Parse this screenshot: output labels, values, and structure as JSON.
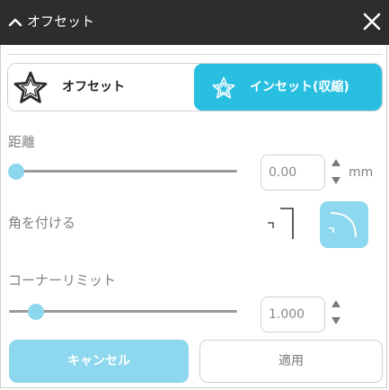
{
  "window": {
    "title": "オフセット"
  },
  "mode_toggle": {
    "offset_label": "オフセット",
    "inset_label": "インセット(収縮)",
    "selected": "inset"
  },
  "distance": {
    "label": "距離",
    "value": "0.00",
    "unit": "mm",
    "slider_level": 0
  },
  "corners": {
    "label": "角を付ける",
    "selected": "rounded"
  },
  "corner_limit": {
    "label": "コーナーリミット",
    "value": "1.000",
    "slider_level": 0.12
  },
  "footer": {
    "cancel_label": "キャンセル",
    "apply_label": "適用"
  },
  "colors": {
    "accent": "#29bfe0",
    "accent_light": "#8ed8ef",
    "titlebar": "#2d2d2d"
  }
}
